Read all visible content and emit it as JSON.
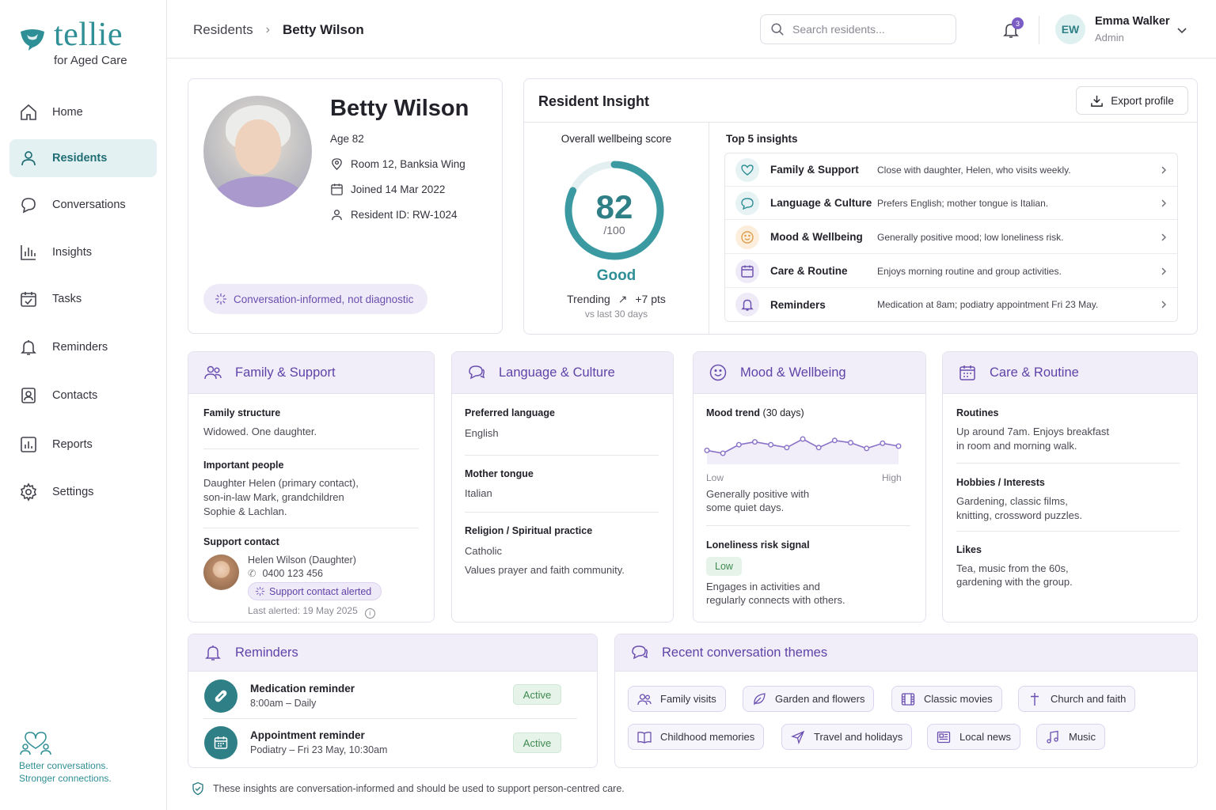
{
  "brand": {
    "name": "tellie",
    "subtitle": "for Aged Care",
    "tagline_1": "Better conversations.",
    "tagline_2": "Stronger connections."
  },
  "nav": [
    {
      "label": "Home",
      "icon": "home-icon"
    },
    {
      "label": "Residents",
      "icon": "person-icon",
      "active": true
    },
    {
      "label": "Conversations",
      "icon": "chat-icon"
    },
    {
      "label": "Insights",
      "icon": "bar-chart-icon"
    },
    {
      "label": "Tasks",
      "icon": "calendar-check-icon"
    },
    {
      "label": "Reminders",
      "icon": "bell-icon"
    },
    {
      "label": "Contacts",
      "icon": "contact-card-icon"
    },
    {
      "label": "Reports",
      "icon": "report-icon"
    },
    {
      "label": "Settings",
      "icon": "gear-icon"
    }
  ],
  "header": {
    "breadcrumb_root": "Residents",
    "breadcrumb_current": "Betty Wilson",
    "search_placeholder": "Search residents...",
    "notification_count": "3",
    "user_initials": "EW",
    "user_name": "Emma Walker",
    "user_role": "Admin"
  },
  "profile": {
    "name": "Betty Wilson",
    "age": "Age 82",
    "room": "Room 12, Banksia Wing",
    "joined": "Joined 14 Mar 2022",
    "resident_id": "Resident ID: RW-1024",
    "note": "Conversation-informed, not diagnostic"
  },
  "insight": {
    "title": "Resident Insight",
    "export_label": "Export profile",
    "wellbeing_label": "Overall wellbeing score",
    "score": "82",
    "score_value": 82,
    "score_max": "/100",
    "rating": "Good",
    "trending_label": "Trending",
    "trending_value": "+7 pts",
    "trending_period": "vs last 30 days",
    "top_label": "Top 5 insights",
    "items": [
      {
        "category": "Family & Support",
        "text": "Close with daughter, Helen, who visits weekly.",
        "icon": "heart-icon"
      },
      {
        "category": "Language & Culture",
        "text": "Prefers English; mother tongue is Italian.",
        "icon": "chat-icon"
      },
      {
        "category": "Mood & Wellbeing",
        "text": "Generally positive mood; low loneliness risk.",
        "icon": "smile-icon"
      },
      {
        "category": "Care & Routine",
        "text": "Enjoys morning routine and group activities.",
        "icon": "calendar-icon"
      },
      {
        "category": "Reminders",
        "text": "Medication at 8am; podiatry appointment Fri 23 May.",
        "icon": "bell-icon"
      }
    ]
  },
  "family": {
    "title": "Family & Support",
    "structure_label": "Family structure",
    "structure": "Widowed. One daughter.",
    "people_label": "Important people",
    "people_1": "Daughter Helen (primary contact),",
    "people_2": "son-in-law Mark, grandchildren",
    "people_3": "Sophie & Lachlan.",
    "contact_label": "Support contact",
    "contact_name": "Helen Wilson (Daughter)",
    "contact_phone": "0400 123 456",
    "alert_label": "Support contact alerted",
    "last_alerted": "Last alerted: 19 May 2025"
  },
  "language": {
    "title": "Language & Culture",
    "preferred_label": "Preferred language",
    "preferred": "English",
    "mother_label": "Mother tongue",
    "mother": "Italian",
    "religion_label": "Religion / Spiritual practice",
    "religion": "Catholic",
    "religion_note": "Values prayer and faith community."
  },
  "mood": {
    "title": "Mood & Wellbeing",
    "trend_label": "Mood trend",
    "trend_period": "(30 days)",
    "trend_values": [
      0.35,
      0.25,
      0.55,
      0.65,
      0.55,
      0.45,
      0.75,
      0.45,
      0.7,
      0.62,
      0.42,
      0.6,
      0.5
    ],
    "axis_low": "Low",
    "axis_high": "High",
    "summary_1": "Generally positive with",
    "summary_2": "some quiet days.",
    "loneliness_label": "Loneliness risk signal",
    "loneliness_value": "Low",
    "loneliness_note_1": "Engages in activities and",
    "loneliness_note_2": "regularly connects with others."
  },
  "care": {
    "title": "Care & Routine",
    "routines_label": "Routines",
    "routines_1": "Up around 7am. Enjoys breakfast",
    "routines_2": "in room and morning walk.",
    "hobbies_label": "Hobbies / Interests",
    "hobbies_1": "Gardening, classic films,",
    "hobbies_2": "knitting, crossword puzzles.",
    "likes_label": "Likes",
    "likes_1": "Tea, music from the 60s,",
    "likes_2": "gardening with the group."
  },
  "reminders": {
    "title": "Reminders",
    "items": [
      {
        "title": "Medication reminder",
        "detail": "8:00am – Daily",
        "status": "Active",
        "icon": "pill-icon"
      },
      {
        "title": "Appointment reminder",
        "detail": "Podiatry – Fri 23 May, 10:30am",
        "status": "Active",
        "icon": "calendar-icon"
      }
    ]
  },
  "themes": {
    "title": "Recent conversation themes",
    "items": [
      {
        "label": "Family visits",
        "icon": "people-icon"
      },
      {
        "label": "Garden and flowers",
        "icon": "leaf-icon"
      },
      {
        "label": "Classic movies",
        "icon": "film-icon"
      },
      {
        "label": "Church and faith",
        "icon": "cross-icon"
      },
      {
        "label": "Childhood memories",
        "icon": "book-icon"
      },
      {
        "label": "Travel and holidays",
        "icon": "plane-icon"
      },
      {
        "label": "Local news",
        "icon": "newspaper-icon"
      },
      {
        "label": "Music",
        "icon": "music-icon"
      }
    ]
  },
  "footer_note": "These insights are conversation-informed and should be used to support person-centred care.",
  "colors": {
    "brand_teal": "#2f8f96",
    "accent_purple": "#5f43a8",
    "status_green": "#3f8a52",
    "lavender_bg": "#f1eef9"
  }
}
